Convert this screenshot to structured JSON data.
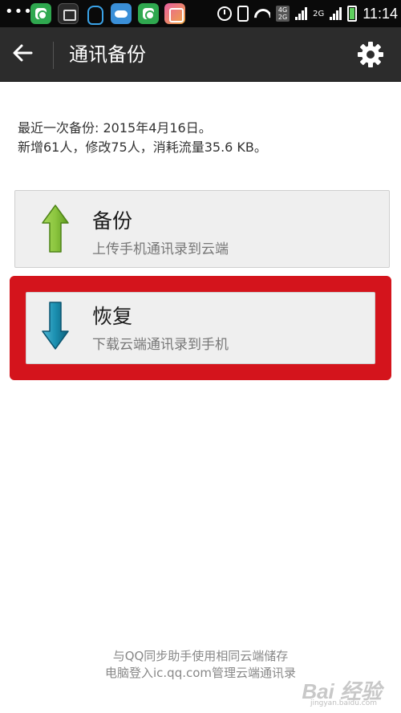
{
  "status_bar": {
    "dots": "•••",
    "network_badge": "4G\n2G",
    "network_label": "2G",
    "time": "11:14"
  },
  "header": {
    "title": "通讯备份"
  },
  "info": {
    "line1": "最近一次备份: 2015年4月16日。",
    "line2": "新增61人，修改75人，消耗流量35.6 KB。"
  },
  "actions": {
    "backup": {
      "title": "备份",
      "subtitle": "上传手机通讯录到云端"
    },
    "restore": {
      "title": "恢复",
      "subtitle": "下载云端通讯录到手机"
    }
  },
  "footer": {
    "line1": "与QQ同步助手使用相同云端储存",
    "line2": "电脑登入ic.qq.com管理云端通讯录"
  },
  "watermark": {
    "text": "Bai 经验",
    "sub": "jingyan.baidu.com"
  },
  "colors": {
    "action_bar": "#2c2c2c",
    "highlight": "#d4141c",
    "backup_arrow": "#8cc63f",
    "restore_arrow": "#1a8fb0"
  }
}
